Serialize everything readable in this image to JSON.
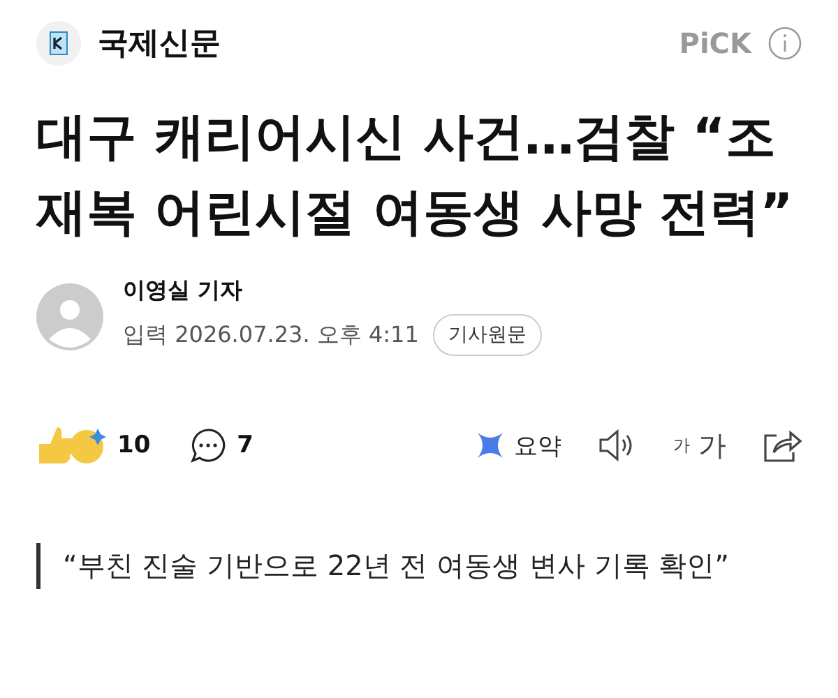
{
  "header": {
    "press": "국제신문",
    "pick": "PiCK"
  },
  "headline": "대구 캐리어시신 사건…검찰 “조재복 어린시절 여동생 사망 전력”",
  "author": {
    "name": "이영실 기자",
    "date": "입력 2026.07.23. 오후 4:11",
    "original_button": "기사원문"
  },
  "actions": {
    "reactions": "10",
    "comments": "7",
    "summary": "요약",
    "font_small": "가",
    "font_large": "가"
  },
  "quote": "“부친 진술 기반으로 22년 전 여동생 변사 기록 확인”"
}
